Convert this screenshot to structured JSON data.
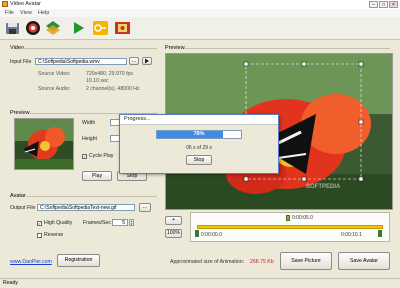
{
  "window": {
    "title": "Video Avatar",
    "minimize": "–",
    "maximize": "□",
    "close": "×"
  },
  "menu": [
    "File",
    "View",
    "Help"
  ],
  "toolbar": {
    "icons": [
      "save-icon",
      "record-icon",
      "layers-icon",
      "play-icon",
      "key-icon",
      "film-icon"
    ]
  },
  "video": {
    "group_label": "Video",
    "input_file_label": "Input File",
    "input_file_value": "C:\\Softpedia\\Softpedia.wmv",
    "browse": "...",
    "source_video_label": "Source Video:",
    "source_video_value": "720x480, 29.970 fps",
    "source_video_duration": "10.10 sec",
    "source_audio_label": "Source Audio:",
    "source_audio_value": "2 channel(s), 48000 Hz"
  },
  "preview_small": {
    "group_label": "Preview",
    "width_label": "Width",
    "height_label": "Height",
    "cycle_play_label": "Cycle Play",
    "cycle_play_checked": true,
    "play_label": "Play",
    "stop_label": "Stop"
  },
  "avatar": {
    "group_label": "Avatar",
    "output_file_label": "Output File",
    "output_file_value": "C:\\Softpedia\\SoftpediaTest-new.gif",
    "browse": "...",
    "high_quality_label": "High Quality",
    "high_quality_checked": true,
    "frames_label": "Frames/Sec",
    "frames_value": "5",
    "reverse_label": "Reverse",
    "reverse_checked": false
  },
  "footer": {
    "link": "www.DanPlei.com",
    "registration_label": "Registration",
    "approx_label": "Approximated size of Animation:",
    "approx_value": "268.75 Kb",
    "save_picture_label": "Save Picture",
    "save_avatar_label": "Save Avatar"
  },
  "preview_main": {
    "group_label": "Preview",
    "watermark": "SOFTPEDIA"
  },
  "zoom": {
    "plus": "+",
    "value": "100%"
  },
  "timeline": {
    "current": "0:00:05.0",
    "start": "0:00:00.0",
    "end": "0:00:10.1"
  },
  "progress": {
    "title": "Progress...",
    "percent_text": "78%",
    "percent": 78,
    "count_text": "06 s of 29 s",
    "stop_label": "Stop"
  },
  "status": {
    "text": "Ready"
  },
  "colors": {
    "progress_fill": "#3e8be8",
    "size_value": "#cc2222",
    "timeline_bar": "#f2c400"
  }
}
